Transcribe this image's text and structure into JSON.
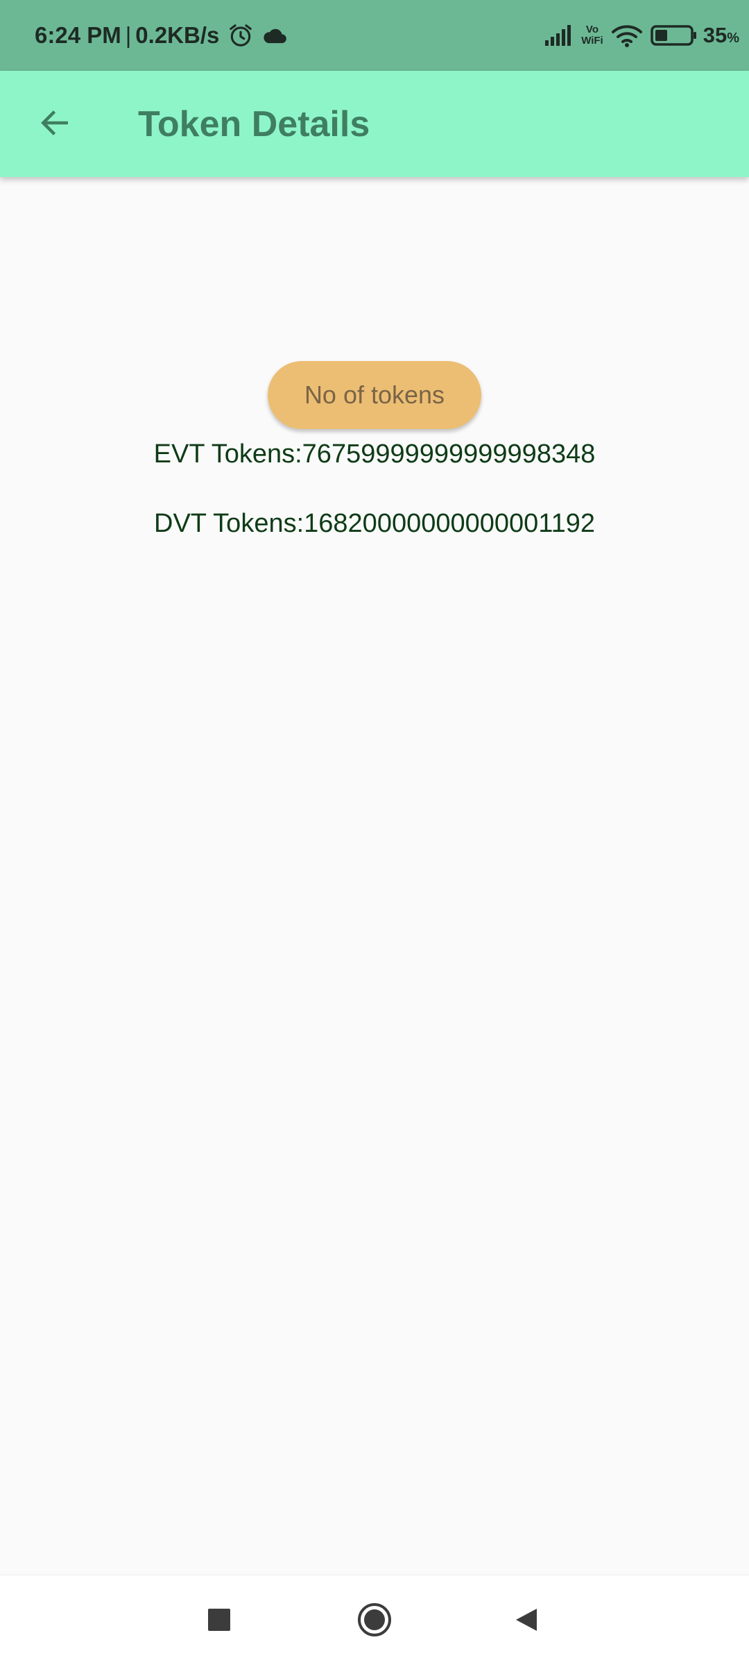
{
  "status_bar": {
    "time": "6:24 PM",
    "separator": "|",
    "network_speed": "0.2KB/s",
    "vowifi_top": "Vo",
    "vowifi_bottom": "WiFi",
    "battery_percent": "35",
    "battery_unit": "%",
    "battery_level": 0.35,
    "icons": [
      "alarm-icon",
      "cloud-icon",
      "signal-icon",
      "vowifi-icon",
      "wifi-icon",
      "battery-icon"
    ]
  },
  "app_bar": {
    "title": "Token Details",
    "back_icon": "arrow-back-icon",
    "background": "#8ef5c8"
  },
  "content": {
    "button_label": "No of tokens",
    "evt_tokens": "EVT Tokens:76759999999999998348",
    "dvt_tokens": "DVT Tokens:16820000000000001192"
  },
  "nav_bar": {
    "icons": [
      "recents-square-icon",
      "home-circle-icon",
      "back-triangle-icon"
    ]
  },
  "colors": {
    "status_bar": "#6cb895",
    "app_bar": "#8ef5c8",
    "title_text": "#3f7e60",
    "button": "#ecbe74",
    "button_text": "#7a6445",
    "token_text": "#0e3b16",
    "background": "#fafafa"
  }
}
